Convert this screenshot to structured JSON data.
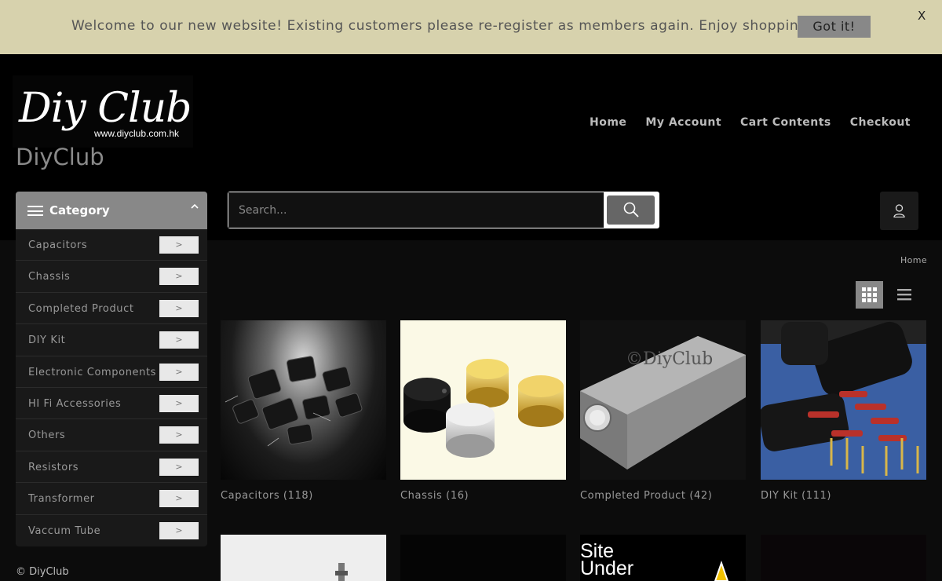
{
  "notice": {
    "message": "Welcome to our new website! Existing customers please re-register as members again. Enjoy shopping!",
    "button": "Got it!",
    "close": "X"
  },
  "header": {
    "logo_text": "Diy Club",
    "logo_url": "www.diyclub.com.hk",
    "site_name": "DiyClub",
    "nav": [
      "Home",
      "My Account",
      "Cart Contents",
      "Checkout"
    ]
  },
  "category_menu": {
    "title": "Category",
    "items": [
      "Capacitors",
      "Chassis",
      "Completed Product",
      "DIY Kit",
      "Electronic Components",
      "HI Fi Accessories",
      "Others",
      "Resistors",
      "Transformer",
      "Vaccum Tube"
    ],
    "arrow": ">"
  },
  "search": {
    "placeholder": "Search..."
  },
  "breadcrumb": "Home",
  "products": [
    {
      "label": "Capacitors (118)"
    },
    {
      "label": "Chassis (16)"
    },
    {
      "label": "Completed Product (42)",
      "watermark": "©DiyClub"
    },
    {
      "label": "DIY Kit (111)"
    }
  ],
  "under_construction_text": "Site\nUnder",
  "footer": {
    "copyright": "© DiyClub"
  },
  "colors": {
    "notice_bg": "#d7d2ad",
    "accent_gray": "#888888",
    "page_bg": "#000000"
  }
}
